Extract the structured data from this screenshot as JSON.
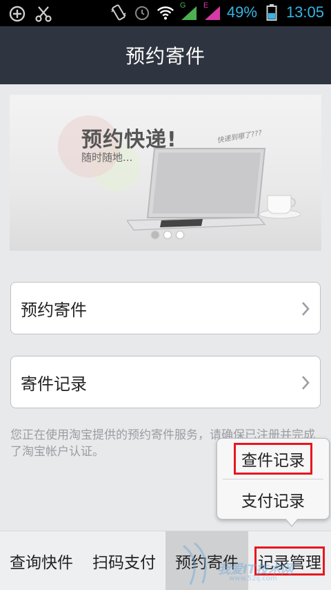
{
  "status_bar": {
    "signal_g_label": "G",
    "signal_e_label": "E",
    "battery": "49%",
    "time": "13:05",
    "accent_color": "#35b5e5"
  },
  "header": {
    "title": "预约寄件"
  },
  "banner": {
    "heading": "预约快递!",
    "subheading": "随时随地...",
    "note": "快递到哪了???",
    "slide_count": 3,
    "active_slide": 2
  },
  "menu": {
    "items": [
      {
        "label": "预约寄件",
        "icon": "chevron-right-icon"
      },
      {
        "label": "寄件记录",
        "icon": "chevron-right-icon"
      }
    ]
  },
  "notice": "您正在使用淘宝提供的预约寄件服务，请确保已注册并完成了淘宝帐户认证。",
  "popup": {
    "items": [
      {
        "label": "查件记录",
        "highlighted": true
      },
      {
        "label": "支付记录",
        "highlighted": false
      }
    ]
  },
  "tabs": [
    {
      "label": "查询快件",
      "active": false
    },
    {
      "label": "扫码支付",
      "active": false
    },
    {
      "label": "预约寄件",
      "active": true
    },
    {
      "label": "记录管理",
      "active": false,
      "highlighted": true
    }
  ],
  "watermark": {
    "text": "我爱IT技术网",
    "url": "www.52ij.com"
  },
  "colors": {
    "title_bar": "#2f3540",
    "highlight_border": "#e8161d",
    "background": "#e8e9eb"
  }
}
